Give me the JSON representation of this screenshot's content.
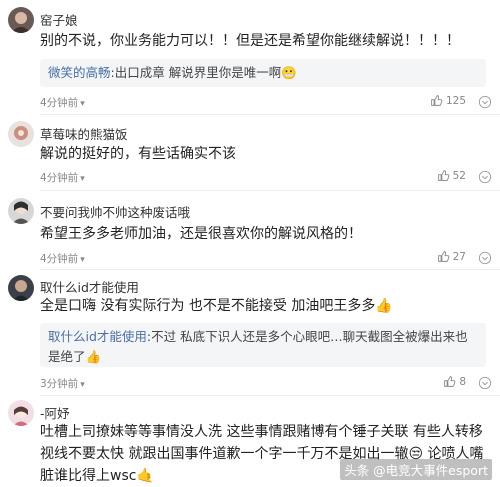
{
  "comments": [
    {
      "username": "窑子娘",
      "text": "别的不说，你业务能力可以！！但是还是希望你能继续解说！！！！",
      "reply": {
        "name": "微笑的高畅",
        "sep": ":",
        "text": "出口成章 解说界里你是唯一啊😬"
      },
      "time": "4分钟前",
      "likes": "125"
    },
    {
      "username": "草莓味的熊猫饭",
      "text": "解说的挺好的，有些话确实不该",
      "time": "4分钟前",
      "likes": "52"
    },
    {
      "username": "不要问我帅不帅这种废话哦",
      "text": "希望王多多老师加油，还是很喜欢你的解说风格的！",
      "time": "4分钟前",
      "likes": "27"
    },
    {
      "username": "取什么id才能使用",
      "text": "全是口嗨 没有实际行为 也不是不能接受 加油吧王多多👍",
      "reply": {
        "name": "取什么id才能使用",
        "sep": ":",
        "text": "不过 私底下识人还是多个心眼吧…聊天截图全被爆出来也是绝了👍"
      },
      "time": "3分钟前",
      "likes": "8"
    },
    {
      "username": "-阿妤",
      "text": "吐槽上司撩妹等等事情没人洗 这些事情跟赌博有个锤子关联 有些人转移视线不要太快 就跟出国事件道歉一个字一千万不是如出一辙😒 论喷人嘴脏谁比得上wsc🤙",
      "time": "",
      "likes": ""
    }
  ],
  "watermark": "头条 @电竞大事件esport",
  "icons": {
    "like": "thumbs-up-icon",
    "more": "circle-more-icon",
    "expand": "chevron-down-icon"
  }
}
